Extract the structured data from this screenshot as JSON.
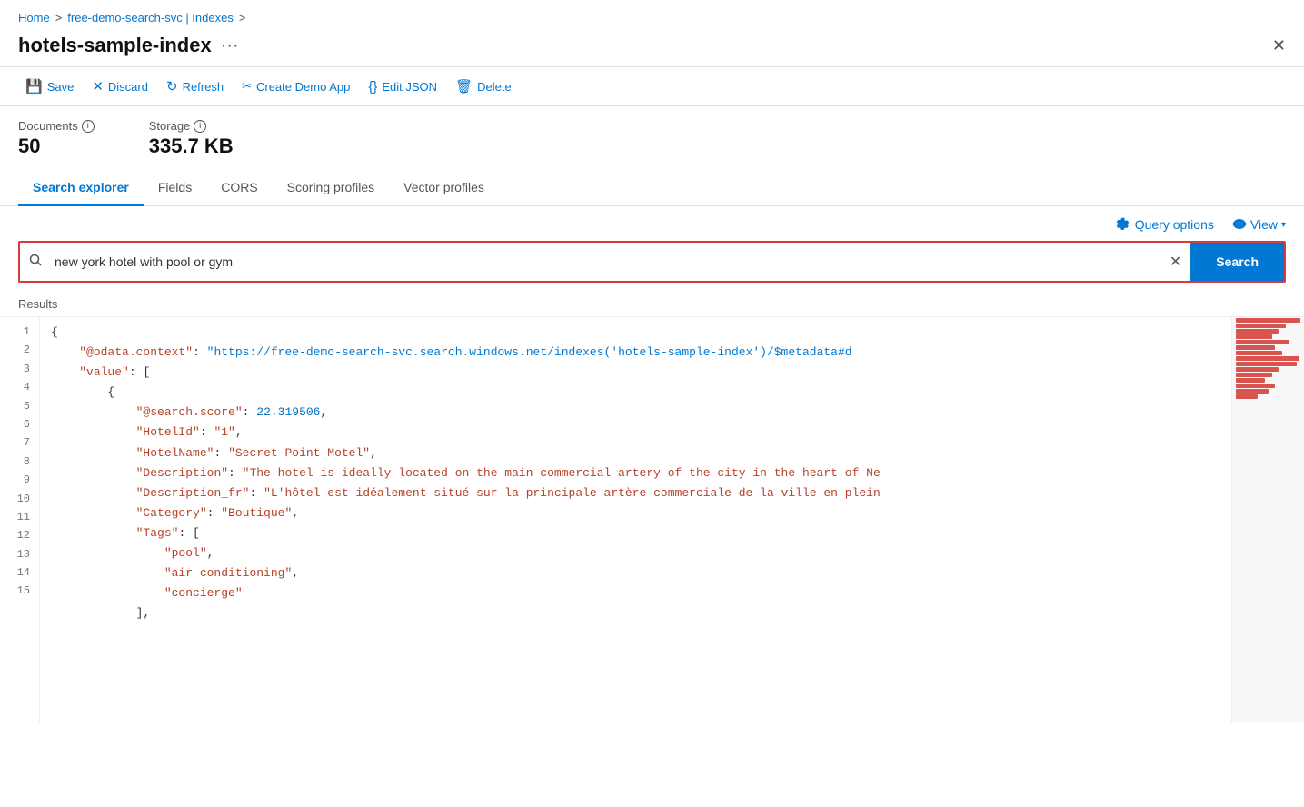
{
  "breadcrumb": {
    "home": "Home",
    "separator1": ">",
    "middle": "free-demo-search-svc | Indexes",
    "separator2": ">"
  },
  "title": "hotels-sample-index",
  "title_dots": "···",
  "toolbar": {
    "save": "Save",
    "discard": "Discard",
    "refresh": "Refresh",
    "create_demo_app": "Create Demo App",
    "edit_json": "Edit JSON",
    "delete": "Delete"
  },
  "stats": {
    "documents_label": "Documents",
    "documents_value": "50",
    "storage_label": "Storage",
    "storage_value": "335.7 KB"
  },
  "tabs": [
    {
      "id": "search-explorer",
      "label": "Search explorer",
      "active": true
    },
    {
      "id": "fields",
      "label": "Fields",
      "active": false
    },
    {
      "id": "cors",
      "label": "CORS",
      "active": false
    },
    {
      "id": "scoring-profiles",
      "label": "Scoring profiles",
      "active": false
    },
    {
      "id": "vector-profiles",
      "label": "Vector profiles",
      "active": false
    }
  ],
  "query_options_label": "Query options",
  "view_label": "View",
  "search_placeholder": "new york hotel with pool or gym",
  "search_button_label": "Search",
  "results_label": "Results",
  "code": {
    "lines": [
      {
        "num": "1",
        "content": "{",
        "type": "brace"
      },
      {
        "num": "2",
        "key": "\"@odata.context\"",
        "colon": ": ",
        "url": "\"https://free-demo-search-svc.search.windows.net/indexes('hotels-sample-index')/$metadata#d",
        "type": "url-line"
      },
      {
        "num": "3",
        "key": "\"value\"",
        "colon": ": [",
        "type": "key-bracket"
      },
      {
        "num": "4",
        "content": "    {",
        "type": "brace"
      },
      {
        "num": "5",
        "key": "\"@search.score\"",
        "colon": ": ",
        "val": "22.319506,",
        "type": "key-num"
      },
      {
        "num": "6",
        "key": "\"HotelId\"",
        "colon": ": ",
        "val": "\"1\",",
        "type": "key-str"
      },
      {
        "num": "7",
        "key": "\"HotelName\"",
        "colon": ": ",
        "val": "\"Secret Point Motel\",",
        "type": "key-str"
      },
      {
        "num": "8",
        "key": "\"Description\"",
        "colon": ": ",
        "val": "\"The hotel is ideally located on the main commercial artery of the city in the heart of Ne",
        "type": "key-str"
      },
      {
        "num": "9",
        "key": "\"Description_fr\"",
        "colon": ": ",
        "val": "\"L'hôtel est idéalement situé sur la principale artère commerciale de la ville en plein",
        "type": "key-str"
      },
      {
        "num": "10",
        "key": "\"Category\"",
        "colon": ": ",
        "val": "\"Boutique\",",
        "type": "key-str"
      },
      {
        "num": "11",
        "key": "\"Tags\"",
        "colon": ": [",
        "type": "key-bracket"
      },
      {
        "num": "12",
        "content": "        \"pool\",",
        "type": "plain-str"
      },
      {
        "num": "13",
        "content": "        \"air conditioning\",",
        "type": "plain-str"
      },
      {
        "num": "14",
        "content": "        \"concierge\"",
        "type": "plain-str"
      },
      {
        "num": "15",
        "content": "    ],",
        "type": "plain"
      }
    ]
  }
}
